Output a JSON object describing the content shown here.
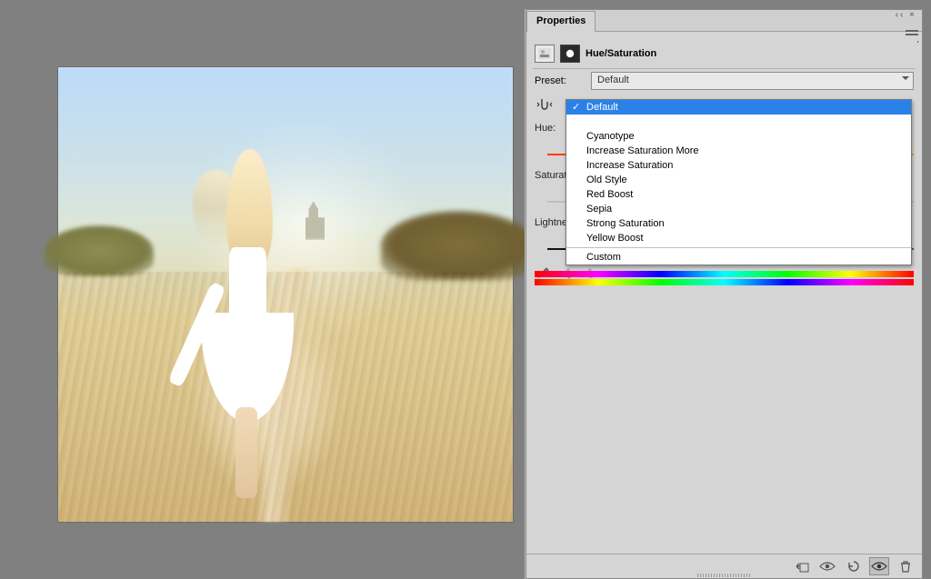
{
  "panel": {
    "tab": "Properties",
    "title": "Hue/Saturation",
    "preset_label": "Preset:",
    "preset_value": "Default",
    "params": {
      "hue_label": "Hue:",
      "saturation_label": "Saturation:",
      "lightness_label": "Lightness:"
    },
    "dropdown": {
      "selected": "Default",
      "groups": [
        [
          "Default"
        ],
        [
          "Cyanotype",
          "Increase Saturation More",
          "Increase Saturation",
          "Old Style",
          "Red Boost",
          "Sepia",
          "Strong Saturation",
          "Yellow Boost"
        ],
        [
          "Custom"
        ]
      ]
    },
    "footer_icons": [
      "clip-to-layer-icon",
      "visibility-icon",
      "reset-icon",
      "view-previous-icon",
      "delete-icon"
    ]
  }
}
